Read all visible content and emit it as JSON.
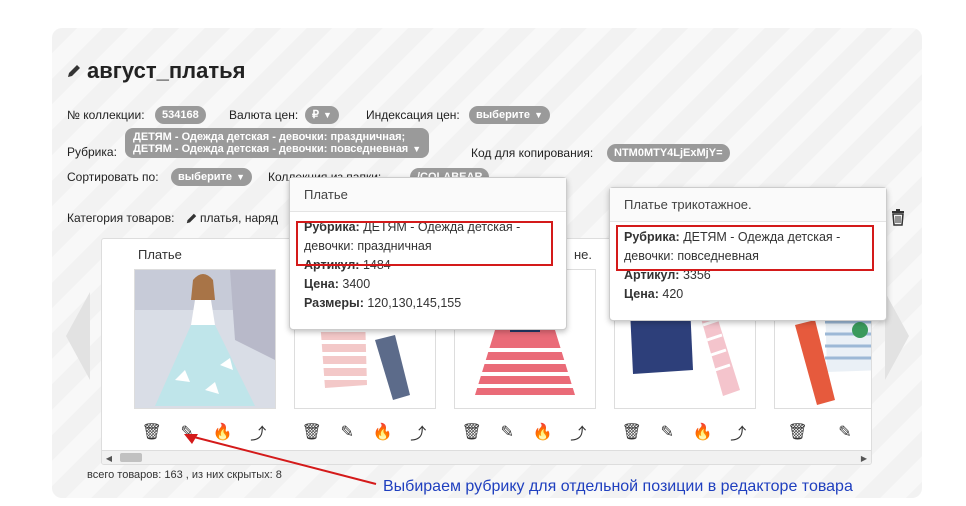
{
  "collection_title": "август_платья",
  "fields": {
    "collection_no_label": "№ коллекции:",
    "collection_no": "534168",
    "currency_label": "Валюта цен:",
    "currency": "₽",
    "indexing_label": "Индексация цен:",
    "indexing": "выберите",
    "rubric_label": "Рубрика:",
    "rubric_line1": "ДЕТЯМ - Одежда детская - девочки: праздничная;",
    "rubric_line2": "ДЕТЯМ - Одежда детская - девочки: повседневная",
    "copy_code_label": "Код для копирования:",
    "copy_code": "NTM0MTY4LjExMjY=",
    "sort_label": "Сортировать по:",
    "sort": "выберите",
    "folder_label": "Коллекция из папки:",
    "folder": "/COLABEAR",
    "category_label": "Категория товаров:",
    "category": "платья, наряд"
  },
  "cards": [
    {
      "title": "Платье",
      "img": "girl-ballgown-dress"
    },
    {
      "title": "",
      "img": "pink-striped-set"
    },
    {
      "title": "",
      "img": "red-striped-dress"
    },
    {
      "title": "не.",
      "img": "navy-pink-set"
    },
    {
      "title": "",
      "img": "striped-red-set"
    }
  ],
  "tooltip_left": {
    "head": "Платье",
    "rubric_label": "Рубрика:",
    "rubric_line1": "ДЕТЯМ - Одежда детская -",
    "rubric_line2": "девочки: праздничная",
    "article_label": "Артикул:",
    "article": "1484",
    "price_label": "Цена:",
    "price": "3400",
    "sizes_label": "Размеры:",
    "sizes": "120,130,145,155"
  },
  "tooltip_right": {
    "head": "Платье трикотажное.",
    "rubric_label": "Рубрика:",
    "rubric_line1": "ДЕТЯМ - Одежда детская -",
    "rubric_line2": "девочки: повседневная",
    "article_label": "Артикул:",
    "article": "3356",
    "price_label": "Цена:",
    "price": "420"
  },
  "footer_text": "всего товаров: 163 , из них скрытых: 8",
  "annotation": "Выбираем рубрику для отдельной позиции в редакторе товара",
  "colors": {
    "pill": "#9a9a9a",
    "annotation": "#1f3fbf",
    "highlight": "#d41a1a"
  }
}
